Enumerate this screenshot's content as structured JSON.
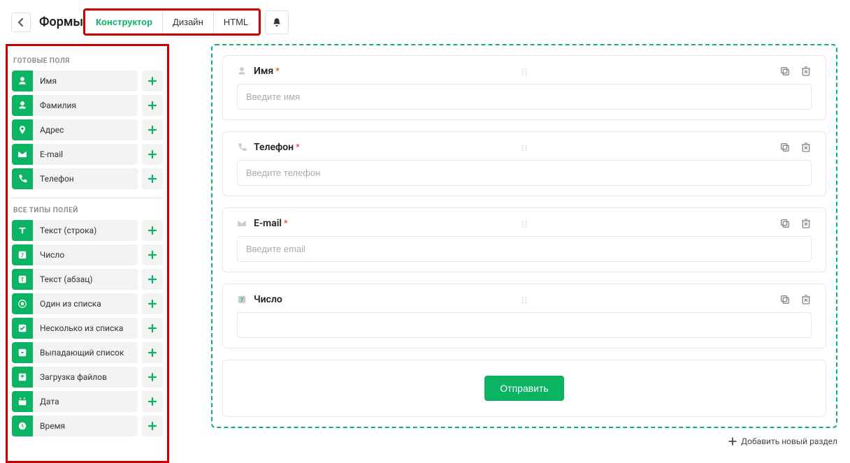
{
  "header": {
    "title": "Формы",
    "tabs": {
      "constructor": "Конструктор",
      "design": "Дизайн",
      "html": "HTML"
    }
  },
  "sidebar": {
    "ready_label": "ГОТОВЫЕ ПОЛЯ",
    "all_label": "ВСЕ ТИПЫ ПОЛЕЙ",
    "ready": [
      {
        "label": "Имя",
        "icon": "person"
      },
      {
        "label": "Фамилия",
        "icon": "person"
      },
      {
        "label": "Адрес",
        "icon": "pin"
      },
      {
        "label": "E-mail",
        "icon": "mail"
      },
      {
        "label": "Телефон",
        "icon": "phone"
      }
    ],
    "all": [
      {
        "label": "Текст (строка)",
        "icon": "text-line"
      },
      {
        "label": "Число",
        "icon": "number"
      },
      {
        "label": "Текст (абзац)",
        "icon": "text-para"
      },
      {
        "label": "Один из списка",
        "icon": "radio"
      },
      {
        "label": "Несколько из списка",
        "icon": "checkbox"
      },
      {
        "label": "Выпадающий список",
        "icon": "dropdown"
      },
      {
        "label": "Загрузка файлов",
        "icon": "upload"
      },
      {
        "label": "Дата",
        "icon": "date"
      },
      {
        "label": "Время",
        "icon": "time"
      }
    ]
  },
  "canvas": {
    "fields": [
      {
        "label": "Имя",
        "required": true,
        "placeholder": "Введите имя",
        "icon": "person"
      },
      {
        "label": "Телефон",
        "required": true,
        "placeholder": "Введите телефон",
        "icon": "phone"
      },
      {
        "label": "E-mail",
        "required": true,
        "placeholder": "Введите email",
        "icon": "mail"
      },
      {
        "label": "Число",
        "required": false,
        "placeholder": "",
        "icon": "number"
      }
    ],
    "submit_label": "Отправить",
    "add_section_label": "Добавить новый раздел"
  }
}
